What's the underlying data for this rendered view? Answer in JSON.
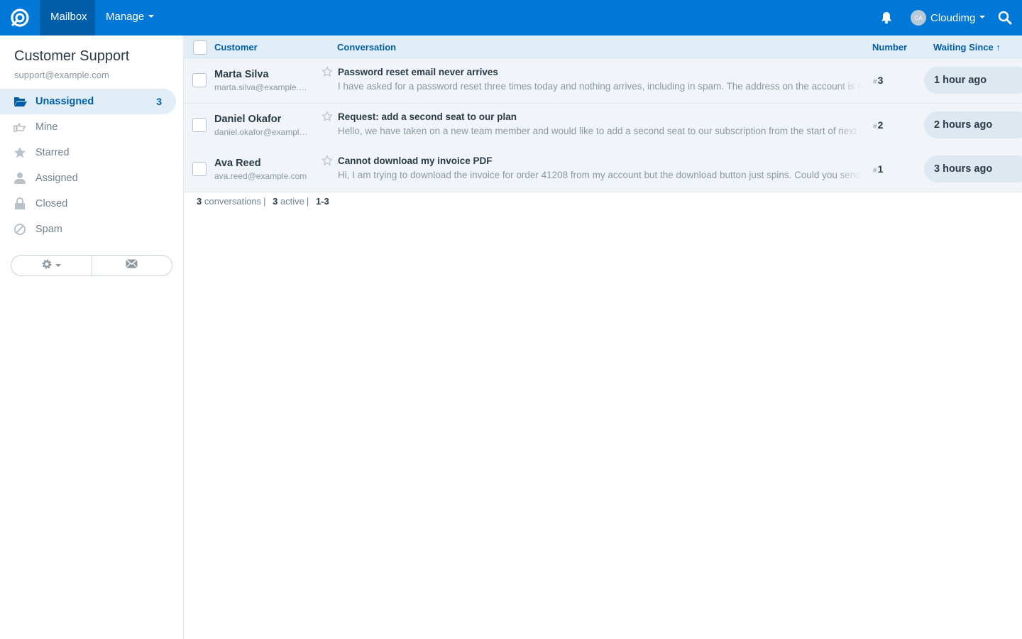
{
  "navbar": {
    "logo_icon": "freescout-logo-icon",
    "mailbox_label": "Mailbox",
    "manage_label": "Manage",
    "user_initials": "CA",
    "user_name": "Cloudimg",
    "colors": {
      "bar": "#0078d7",
      "active": "#005da8"
    }
  },
  "sidebar": {
    "mailbox_name": "Customer Support",
    "mailbox_email": "support@example.com",
    "folders": [
      {
        "label": "Unassigned",
        "icon": "folder-open-icon",
        "count": "3",
        "active": true
      },
      {
        "label": "Mine",
        "icon": "hand-pointing-icon",
        "count": "",
        "active": false
      },
      {
        "label": "Starred",
        "icon": "star-icon",
        "count": "",
        "active": false
      },
      {
        "label": "Assigned",
        "icon": "user-icon",
        "count": "",
        "active": false
      },
      {
        "label": "Closed",
        "icon": "lock-icon",
        "count": "",
        "active": false
      },
      {
        "label": "Spam",
        "icon": "ban-icon",
        "count": "",
        "active": false
      }
    ],
    "actions": {
      "settings_icon": "gear-icon",
      "compose_icon": "envelope-icon"
    }
  },
  "table": {
    "headers": {
      "customer": "Customer",
      "conversation": "Conversation",
      "number": "Number",
      "waiting_since": "Waiting Since ↑"
    },
    "rows": [
      {
        "customer_name": "Marta Silva",
        "customer_email": "marta.silva@example.com",
        "subject": "Password reset email never arrives",
        "preview": "I have asked for a password reset three times today and nothing arrives, including in spam. The address on the account is the one I am writing from.",
        "number_hash": "#",
        "number": "3",
        "waiting": "1 hour ago"
      },
      {
        "customer_name": "Daniel Okafor",
        "customer_email": "daniel.okafor@example.com",
        "subject": "Request: add a second seat to our plan",
        "preview": "Hello, we have taken on a new team member and would like to add a second seat to our subscription from the start of next month.",
        "number_hash": "#",
        "number": "2",
        "waiting": "2 hours ago"
      },
      {
        "customer_name": "Ava Reed",
        "customer_email": "ava.reed@example.com",
        "subject": "Cannot download my invoice PDF",
        "preview": "Hi, I am trying to download the invoice for order 41208 from my account but the download button just spins. Could you send it by email?",
        "number_hash": "#",
        "number": "1",
        "waiting": "3 hours ago"
      }
    ]
  },
  "footer": {
    "conversations_count": "3",
    "conversations_label": "conversations",
    "active_count": "3",
    "active_label": "active",
    "range": "1-3"
  }
}
